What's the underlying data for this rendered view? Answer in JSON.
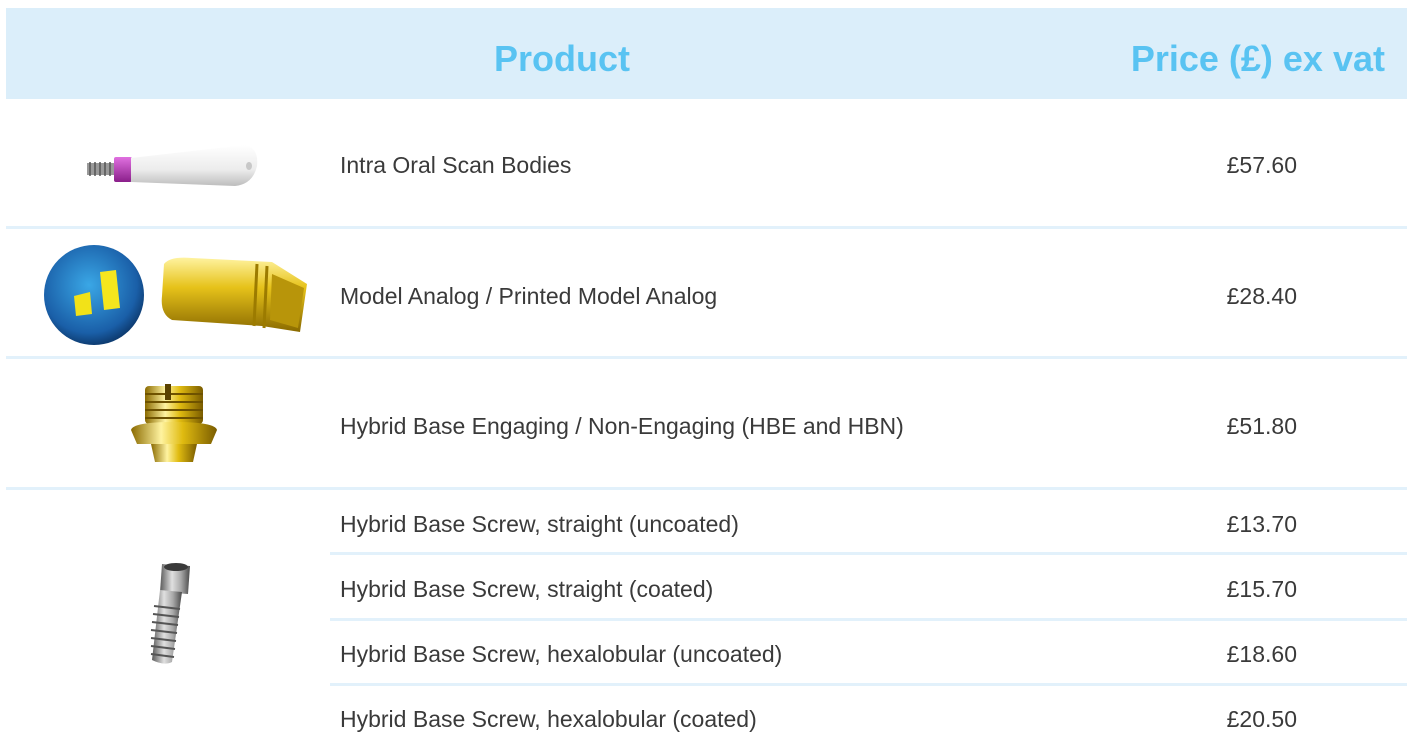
{
  "header": {
    "product_label": "Product",
    "price_label": "Price (£) ex vat"
  },
  "rows": [
    {
      "product": "Intra Oral Scan Bodies",
      "price": "£57.60",
      "image": "scan-body-image"
    },
    {
      "product": "Model Analog / Printed Model Analog",
      "price": "£28.40",
      "image": "model-analog-image"
    },
    {
      "product": "Hybrid Base Engaging / Non-Engaging (HBE and HBN)",
      "price": "£51.80",
      "image": "hybrid-base-image"
    },
    {
      "product": "Hybrid Base Screw, straight (uncoated)",
      "price": "£13.70",
      "image": "screw-image"
    },
    {
      "product": "Hybrid Base Screw, straight (coated)",
      "price": "£15.70"
    },
    {
      "product": "Hybrid Base Screw, hexalobular (uncoated)",
      "price": "£18.60"
    },
    {
      "product": "Hybrid Base Screw, hexalobular (coated)",
      "price": "£20.50"
    }
  ],
  "colors": {
    "header_bg": "#dbeefa",
    "header_text": "#59c3f2",
    "separator": "#e2f1fb",
    "body_text": "#3a3a3a"
  }
}
